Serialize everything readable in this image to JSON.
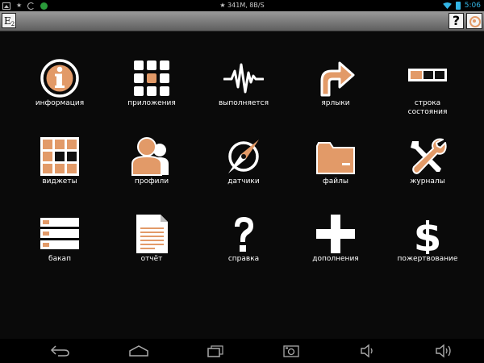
{
  "status_bar": {
    "network_speed": "341M, 8B/S",
    "time": "5:06",
    "accent_color": "#33b5e5"
  },
  "toolbar": {
    "logo_text": "E",
    "logo_sub": "2",
    "help_label": "?"
  },
  "accent_color": "#e29a68",
  "menu": [
    {
      "label": "информация",
      "icon": "info-icon"
    },
    {
      "label": "приложения",
      "icon": "apps-grid-icon"
    },
    {
      "label": "выполняется",
      "icon": "pulse-icon"
    },
    {
      "label": "ярлыки",
      "icon": "shortcut-arrow-icon"
    },
    {
      "label": "строка\nсостояния",
      "icon": "status-bar-icon"
    },
    {
      "label": "виджеты",
      "icon": "widgets-icon"
    },
    {
      "label": "профили",
      "icon": "profiles-icon"
    },
    {
      "label": "датчики",
      "icon": "compass-icon"
    },
    {
      "label": "файлы",
      "icon": "folder-icon"
    },
    {
      "label": "журналы",
      "icon": "tools-icon"
    },
    {
      "label": "бакап",
      "icon": "backup-icon"
    },
    {
      "label": "отчёт",
      "icon": "report-icon"
    },
    {
      "label": "справка",
      "icon": "help-icon"
    },
    {
      "label": "дополнения",
      "icon": "plus-icon"
    },
    {
      "label": "пожертвование",
      "icon": "dollar-icon"
    }
  ],
  "nav_bar": [
    "back-icon",
    "home-icon",
    "recents-icon",
    "screenshot-icon",
    "volume-down-icon",
    "volume-up-icon"
  ]
}
